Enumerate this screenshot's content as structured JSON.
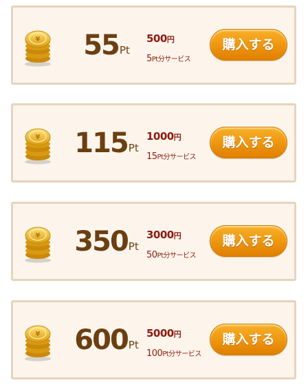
{
  "packages": [
    {
      "points": "55",
      "unit": "Pt",
      "price": "500",
      "price_yen": "円",
      "bonus": "5",
      "bonus_suffix": "Pt分サービス",
      "button": "購入する"
    },
    {
      "points": "115",
      "unit": "Pt",
      "price": "1000",
      "price_yen": "円",
      "bonus": "15",
      "bonus_suffix": "Pt分サービス",
      "button": "購入する"
    },
    {
      "points": "350",
      "unit": "Pt",
      "price": "3000",
      "price_yen": "円",
      "bonus": "50",
      "bonus_suffix": "Pt分サービス",
      "button": "購入する"
    },
    {
      "points": "600",
      "unit": "Pt",
      "price": "5000",
      "price_yen": "円",
      "bonus": "100",
      "bonus_suffix": "Pt分サービス",
      "button": "購入する"
    }
  ],
  "icons": {
    "coin": "coin-stack-icon"
  },
  "colors": {
    "card_bg": "#fdf5ec",
    "card_border": "#e6d4bd",
    "points_text": "#6b3f12",
    "price_text": "#8e1a0f",
    "button_orange": "#f09a12",
    "coin_gold": "#e8b225"
  }
}
